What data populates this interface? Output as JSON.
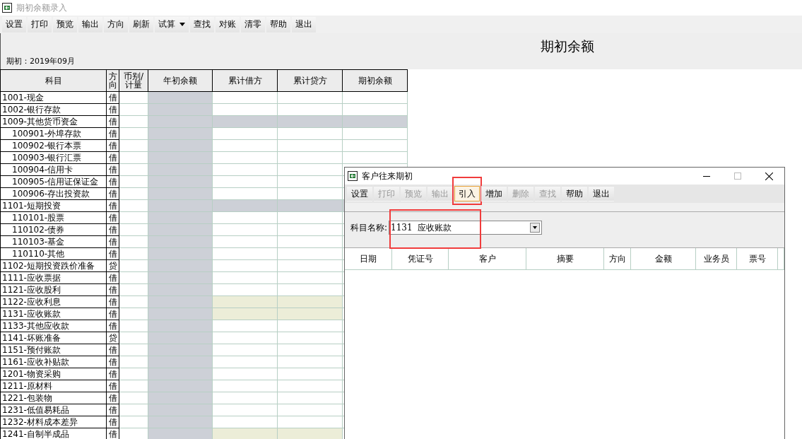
{
  "main_window": {
    "title": "期初余额录入",
    "toolbar": [
      {
        "label": "设置",
        "kind": "button"
      },
      {
        "label": "打印",
        "kind": "button"
      },
      {
        "label": "预览",
        "kind": "button"
      },
      {
        "label": "输出",
        "kind": "button"
      },
      {
        "label": "方向",
        "kind": "button"
      },
      {
        "label": "刷新",
        "kind": "button"
      },
      {
        "label": "试算",
        "kind": "dropdown"
      },
      {
        "label": "查找",
        "kind": "button"
      },
      {
        "label": "对账",
        "kind": "button"
      },
      {
        "label": "清零",
        "kind": "button"
      },
      {
        "label": "帮助",
        "kind": "button"
      },
      {
        "label": "退出",
        "kind": "button"
      }
    ],
    "report_title": "期初余额",
    "period": "期初：2019年09月",
    "table": {
      "columns": [
        "科目",
        "方向",
        "币别/计量",
        "年初余额",
        "累计借方",
        "累计贷方",
        "期初余额"
      ],
      "rows": [
        {
          "account": "1001-现金",
          "direction": "借",
          "kind": "normal"
        },
        {
          "account": "1002-银行存款",
          "direction": "借",
          "kind": "normal"
        },
        {
          "account": "1009-其他货币资金",
          "direction": "借",
          "kind": "summary",
          "children": [
            {
              "account": "100901-外埠存款",
              "direction": "借",
              "kind": "normal"
            },
            {
              "account": "100902-银行本票",
              "direction": "借",
              "kind": "normal"
            },
            {
              "account": "100903-银行汇票",
              "direction": "借",
              "kind": "normal"
            },
            {
              "account": "100904-信用卡",
              "direction": "借",
              "kind": "normal"
            },
            {
              "account": "100905-信用证保证金",
              "direction": "借",
              "kind": "normal"
            },
            {
              "account": "100906-存出投资款",
              "direction": "借",
              "kind": "normal"
            }
          ]
        },
        {
          "account": "1101-短期投资",
          "direction": "借",
          "kind": "summary",
          "children": [
            {
              "account": "110101-股票",
              "direction": "借",
              "kind": "normal"
            },
            {
              "account": "110102-债券",
              "direction": "借",
              "kind": "normal"
            },
            {
              "account": "110103-基金",
              "direction": "借",
              "kind": "normal"
            },
            {
              "account": "110110-其他",
              "direction": "借",
              "kind": "normal"
            }
          ]
        },
        {
          "account": "1102-短期投资跌价准备",
          "direction": "贷",
          "kind": "normal"
        },
        {
          "account": "1111-应收票据",
          "direction": "借",
          "kind": "normal"
        },
        {
          "account": "1121-应收股利",
          "direction": "借",
          "kind": "normal"
        },
        {
          "account": "1122-应收利息",
          "direction": "借",
          "kind": "auxiliary"
        },
        {
          "account": "1131-应收账款",
          "direction": "借",
          "kind": "auxiliary"
        },
        {
          "account": "1133-其他应收款",
          "direction": "借",
          "kind": "normal"
        },
        {
          "account": "1141-坏账准备",
          "direction": "贷",
          "kind": "normal"
        },
        {
          "account": "1151-预付账款",
          "direction": "借",
          "kind": "normal"
        },
        {
          "account": "1161-应收补贴款",
          "direction": "借",
          "kind": "normal"
        },
        {
          "account": "1201-物资采购",
          "direction": "借",
          "kind": "normal"
        },
        {
          "account": "1211-原材料",
          "direction": "借",
          "kind": "normal"
        },
        {
          "account": "1221-包装物",
          "direction": "借",
          "kind": "normal"
        },
        {
          "account": "1231-低值易耗品",
          "direction": "借",
          "kind": "normal"
        },
        {
          "account": "1232-材料成本差异",
          "direction": "借",
          "kind": "normal"
        },
        {
          "account": "1241-自制半成品",
          "direction": "借",
          "kind": "auxiliary"
        }
      ]
    }
  },
  "dialog": {
    "title": "客户往来期初",
    "toolbar": [
      {
        "label": "设置",
        "disabled": false,
        "focused": false,
        "annotated": false
      },
      {
        "label": "打印",
        "disabled": true,
        "focused": false,
        "annotated": false
      },
      {
        "label": "预览",
        "disabled": true,
        "focused": false,
        "annotated": false
      },
      {
        "label": "输出",
        "disabled": true,
        "focused": false,
        "annotated": false
      },
      {
        "label": "引入",
        "disabled": false,
        "focused": true,
        "annotated": true
      },
      {
        "label": "增加",
        "disabled": false,
        "focused": false,
        "annotated": false
      },
      {
        "label": "删除",
        "disabled": true,
        "focused": false,
        "annotated": false
      },
      {
        "label": "查找",
        "disabled": true,
        "focused": false,
        "annotated": false
      },
      {
        "label": "帮助",
        "disabled": false,
        "focused": false,
        "annotated": false
      },
      {
        "label": "退出",
        "disabled": false,
        "focused": false,
        "annotated": false
      }
    ],
    "subject": {
      "label": "科目名称:",
      "value": "1131  应收账款",
      "annotated": true
    },
    "columns": [
      "日期",
      "凭证号",
      "客户",
      "摘要",
      "方向",
      "金额",
      "业务员",
      "票号"
    ]
  }
}
